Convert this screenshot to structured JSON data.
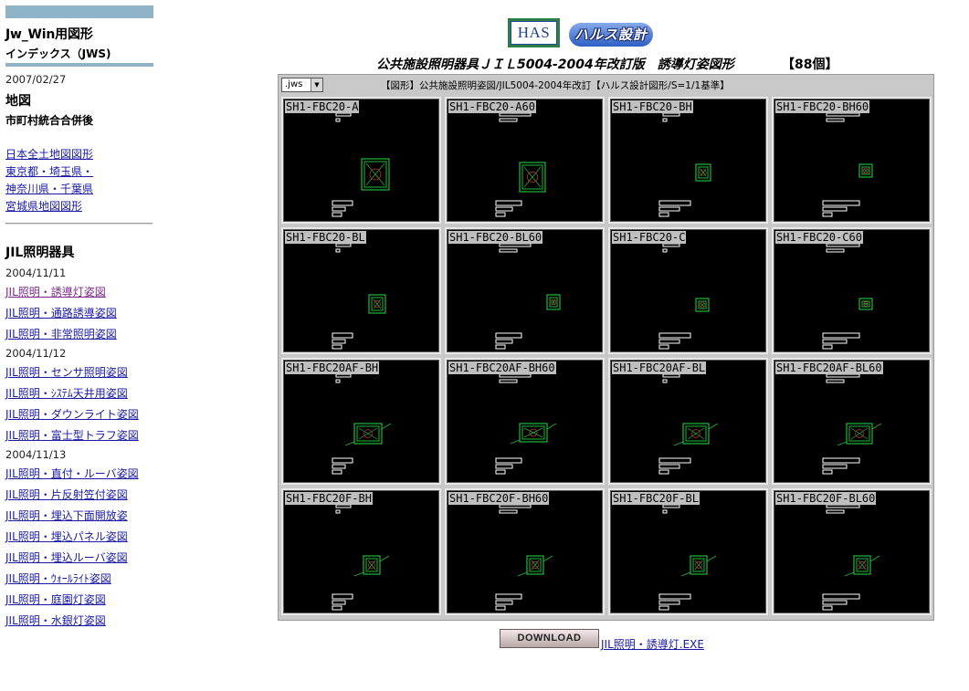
{
  "sidebar": {
    "title": "Jw_Win用図形",
    "subtitle": "インデックス（JWS)",
    "date_top": "2007/02/27",
    "map_heading": "地図",
    "map_sub": "市町村統合合併後",
    "map_links": [
      "日本全土地図図形",
      "東京都・埼玉県・",
      "神奈川県・千葉県",
      "宮城県地図図形"
    ],
    "jil_heading": "JIL照明器具",
    "date_1": "2004/11/11",
    "links_1": [
      "JIL照明・誘導灯姿図",
      "JIL照明・通路誘導姿図",
      "JIL照明・非常照明姿図"
    ],
    "date_2": "2004/11/12",
    "links_2": [
      "JIL照明・センサ照明姿図",
      "JIL照明・ｼｽﾃﾑ天井用姿図",
      "JIL照明・ダウンライト姿図",
      "JIL照明・富士型トラフ姿図"
    ],
    "date_3": "2004/11/13",
    "links_3": [
      "JIL照明・直付・ルーバ姿図",
      "JIL照明・片反射笠付姿図",
      "JIL照明・埋込下面開放姿",
      "JIL照明・埋込パネル姿図",
      "JIL照明・埋込ルーバ姿図",
      "JIL照明・ｳｫｰﾙﾗｲﾄ姿図",
      "JIL照明・庭園灯姿図",
      "JIL照明・水銀灯姿図"
    ]
  },
  "header": {
    "logo_text": "HAS",
    "brand_text": "ハルス設計",
    "title": "公共施設照明器具ＪＩＬ5004-2004年改訂版　誘導灯姿図形",
    "count": "【88個】"
  },
  "gallery": {
    "file_ext": ".jws",
    "caption": "【図形】公共施設照明姿図/JIL5004-2004年改訂【ハルス設計図形/S=1/1基準】",
    "items": [
      "SH1-FBC20-A",
      "SH1-FBC20-A60",
      "SH1-FBC20-BH",
      "SH1-FBC20-BH60",
      "SH1-FBC20-BL",
      "SH1-FBC20-BL60",
      "SH1-FBC20-C",
      "SH1-FBC20-C60",
      "SH1-FBC20AF-BH",
      "SH1-FBC20AF-BH60",
      "SH1-FBC20AF-BL",
      "SH1-FBC20AF-BL60",
      "SH1-FBC20F-BH",
      "SH1-FBC20F-BH60",
      "SH1-FBC20F-BL",
      "SH1-FBC20F-BL60"
    ]
  },
  "download": {
    "button_label": "DOWNLOAD",
    "link_text": "JIL照明・誘導灯.EXE"
  },
  "colors": {
    "accent_bar": "#8fb4c8",
    "link": "#1a1aa6",
    "visited_link": "#7b2a8a",
    "drawing_green": "#1fb83a"
  }
}
